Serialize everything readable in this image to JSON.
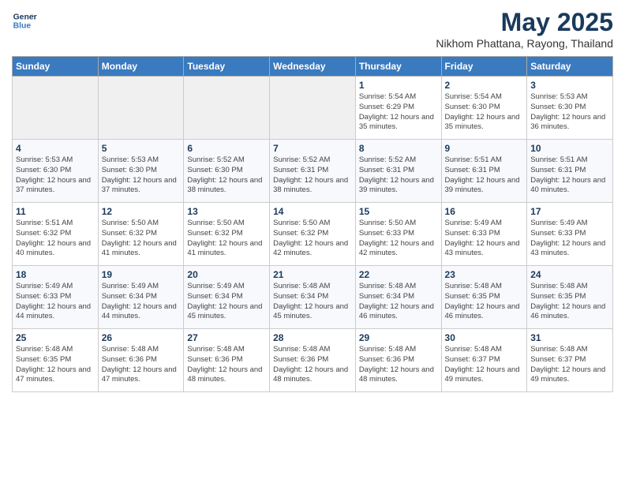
{
  "header": {
    "logo_line1": "General",
    "logo_line2": "Blue",
    "month_title": "May 2025",
    "subtitle": "Nikhom Phattana, Rayong, Thailand"
  },
  "days_of_week": [
    "Sunday",
    "Monday",
    "Tuesday",
    "Wednesday",
    "Thursday",
    "Friday",
    "Saturday"
  ],
  "weeks": [
    [
      {
        "day": "",
        "empty": true
      },
      {
        "day": "",
        "empty": true
      },
      {
        "day": "",
        "empty": true
      },
      {
        "day": "",
        "empty": true
      },
      {
        "day": "1",
        "sunrise": "5:54 AM",
        "sunset": "6:29 PM",
        "daylight": "12 hours and 35 minutes."
      },
      {
        "day": "2",
        "sunrise": "5:54 AM",
        "sunset": "6:30 PM",
        "daylight": "12 hours and 35 minutes."
      },
      {
        "day": "3",
        "sunrise": "5:53 AM",
        "sunset": "6:30 PM",
        "daylight": "12 hours and 36 minutes."
      }
    ],
    [
      {
        "day": "4",
        "sunrise": "5:53 AM",
        "sunset": "6:30 PM",
        "daylight": "12 hours and 37 minutes."
      },
      {
        "day": "5",
        "sunrise": "5:53 AM",
        "sunset": "6:30 PM",
        "daylight": "12 hours and 37 minutes."
      },
      {
        "day": "6",
        "sunrise": "5:52 AM",
        "sunset": "6:30 PM",
        "daylight": "12 hours and 38 minutes."
      },
      {
        "day": "7",
        "sunrise": "5:52 AM",
        "sunset": "6:31 PM",
        "daylight": "12 hours and 38 minutes."
      },
      {
        "day": "8",
        "sunrise": "5:52 AM",
        "sunset": "6:31 PM",
        "daylight": "12 hours and 39 minutes."
      },
      {
        "day": "9",
        "sunrise": "5:51 AM",
        "sunset": "6:31 PM",
        "daylight": "12 hours and 39 minutes."
      },
      {
        "day": "10",
        "sunrise": "5:51 AM",
        "sunset": "6:31 PM",
        "daylight": "12 hours and 40 minutes."
      }
    ],
    [
      {
        "day": "11",
        "sunrise": "5:51 AM",
        "sunset": "6:32 PM",
        "daylight": "12 hours and 40 minutes."
      },
      {
        "day": "12",
        "sunrise": "5:50 AM",
        "sunset": "6:32 PM",
        "daylight": "12 hours and 41 minutes."
      },
      {
        "day": "13",
        "sunrise": "5:50 AM",
        "sunset": "6:32 PM",
        "daylight": "12 hours and 41 minutes."
      },
      {
        "day": "14",
        "sunrise": "5:50 AM",
        "sunset": "6:32 PM",
        "daylight": "12 hours and 42 minutes."
      },
      {
        "day": "15",
        "sunrise": "5:50 AM",
        "sunset": "6:33 PM",
        "daylight": "12 hours and 42 minutes."
      },
      {
        "day": "16",
        "sunrise": "5:49 AM",
        "sunset": "6:33 PM",
        "daylight": "12 hours and 43 minutes."
      },
      {
        "day": "17",
        "sunrise": "5:49 AM",
        "sunset": "6:33 PM",
        "daylight": "12 hours and 43 minutes."
      }
    ],
    [
      {
        "day": "18",
        "sunrise": "5:49 AM",
        "sunset": "6:33 PM",
        "daylight": "12 hours and 44 minutes."
      },
      {
        "day": "19",
        "sunrise": "5:49 AM",
        "sunset": "6:34 PM",
        "daylight": "12 hours and 44 minutes."
      },
      {
        "day": "20",
        "sunrise": "5:49 AM",
        "sunset": "6:34 PM",
        "daylight": "12 hours and 45 minutes."
      },
      {
        "day": "21",
        "sunrise": "5:48 AM",
        "sunset": "6:34 PM",
        "daylight": "12 hours and 45 minutes."
      },
      {
        "day": "22",
        "sunrise": "5:48 AM",
        "sunset": "6:34 PM",
        "daylight": "12 hours and 46 minutes."
      },
      {
        "day": "23",
        "sunrise": "5:48 AM",
        "sunset": "6:35 PM",
        "daylight": "12 hours and 46 minutes."
      },
      {
        "day": "24",
        "sunrise": "5:48 AM",
        "sunset": "6:35 PM",
        "daylight": "12 hours and 46 minutes."
      }
    ],
    [
      {
        "day": "25",
        "sunrise": "5:48 AM",
        "sunset": "6:35 PM",
        "daylight": "12 hours and 47 minutes."
      },
      {
        "day": "26",
        "sunrise": "5:48 AM",
        "sunset": "6:36 PM",
        "daylight": "12 hours and 47 minutes."
      },
      {
        "day": "27",
        "sunrise": "5:48 AM",
        "sunset": "6:36 PM",
        "daylight": "12 hours and 48 minutes."
      },
      {
        "day": "28",
        "sunrise": "5:48 AM",
        "sunset": "6:36 PM",
        "daylight": "12 hours and 48 minutes."
      },
      {
        "day": "29",
        "sunrise": "5:48 AM",
        "sunset": "6:36 PM",
        "daylight": "12 hours and 48 minutes."
      },
      {
        "day": "30",
        "sunrise": "5:48 AM",
        "sunset": "6:37 PM",
        "daylight": "12 hours and 49 minutes."
      },
      {
        "day": "31",
        "sunrise": "5:48 AM",
        "sunset": "6:37 PM",
        "daylight": "12 hours and 49 minutes."
      }
    ]
  ]
}
